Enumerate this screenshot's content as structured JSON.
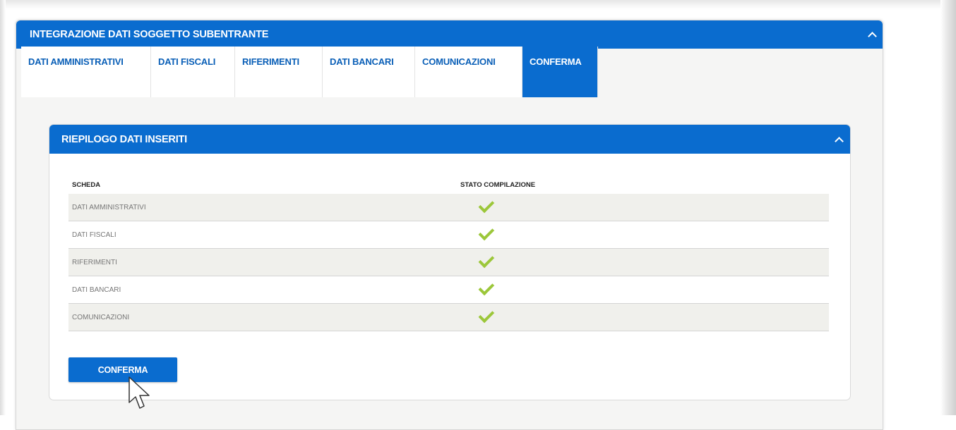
{
  "outer_panel": {
    "title": "INTEGRAZIONE DATI SOGGETTO SUBENTRANTE",
    "collapse_icon": "chevron-up-icon"
  },
  "tabs": [
    {
      "label": "DATI AMMINISTRATIVI",
      "active": false
    },
    {
      "label": "DATI FISCALI",
      "active": false
    },
    {
      "label": "RIFERIMENTI",
      "active": false
    },
    {
      "label": "DATI BANCARI",
      "active": false
    },
    {
      "label": "COMUNICAZIONI",
      "active": false
    },
    {
      "label": "CONFERMA",
      "active": true
    }
  ],
  "summary_panel": {
    "title": "RIEPILOGO DATI INSERITI",
    "collapse_icon": "chevron-up-icon",
    "columns": [
      "SCHEDA",
      "STATO COMPILAZIONE"
    ],
    "rows": [
      {
        "scheda": "DATI AMMINISTRATIVI",
        "status_icon": "check-icon"
      },
      {
        "scheda": "DATI FISCALI",
        "status_icon": "check-icon"
      },
      {
        "scheda": "RIFERIMENTI",
        "status_icon": "check-icon"
      },
      {
        "scheda": "DATI BANCARI",
        "status_icon": "check-icon"
      },
      {
        "scheda": "COMUNICAZIONI",
        "status_icon": "check-icon"
      }
    ],
    "confirm_label": "CONFERMA"
  },
  "colors": {
    "primary": "#0a6ccf",
    "tab_text": "#0a5fb7",
    "check": "#9cc73a",
    "row_alt": "#f0f0ec"
  }
}
